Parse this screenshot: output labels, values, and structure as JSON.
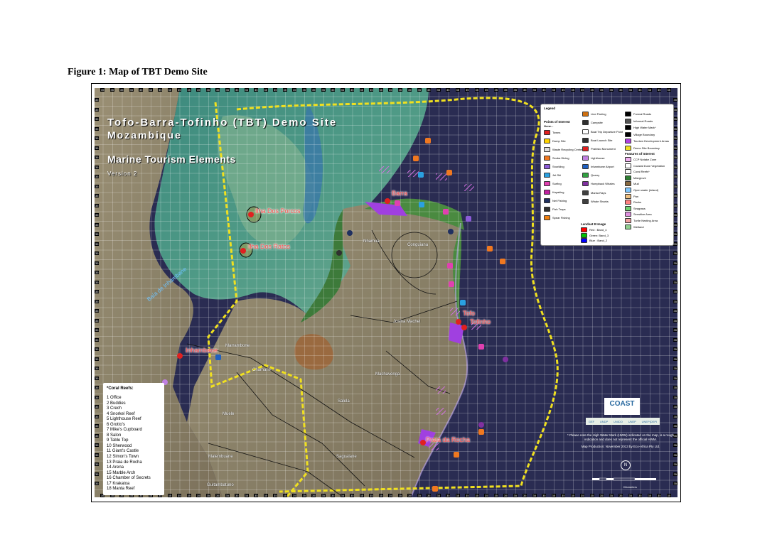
{
  "caption": "Figure 1: Map of TBT Demo Site",
  "map": {
    "title_line1": "Tofo-Barra-Tofinho (TBT) Demo Site",
    "title_line2": "Mozambique",
    "subtitle": "Marine Tourism Elements",
    "version": "Version 2",
    "places": {
      "ilha_porcos": "Ilha Dos Porcos",
      "ilha_ratos": "Ilha Dos Ratos",
      "inhambane": "Inhambane",
      "barra": "Barra",
      "tofo": "Tofo",
      "tofinho": "Tofinho",
      "praia_rocha": "Praia da Rocha"
    },
    "districts": {
      "conguiana": "Conguiana",
      "josina_machel": "Josina Machel",
      "marrambone": "Marrambone",
      "chamane": "Chamane",
      "nhamua": "Nhamua",
      "muele": "Muele",
      "malembuane": "Malembuane",
      "guitambatuno": "Guitambatuno",
      "salela": "Salela",
      "sagualane": "Sagualane",
      "machavenga": "Machavenga"
    },
    "bay_label": "Baía de Inhambane",
    "grid_edge_label": "35"
  },
  "legend": {
    "title": "Legend",
    "poi_heading": "Points of Interest",
    "poi_sub": "Gene...",
    "items_col1": [
      {
        "label": "Towns",
        "color": "#e02020"
      },
      {
        "label": "Dump Site",
        "color": "#ffd400"
      },
      {
        "label": "Waste Recycling Centre",
        "color": "#dddddd"
      },
      {
        "label": "Scuba Diving",
        "color": "#f07820"
      },
      {
        "label": "Snorkling",
        "color": "#8c5cd8"
      },
      {
        "label": "Jet Ski",
        "color": "#2aa0e0"
      },
      {
        "label": "Surfing",
        "color": "#e040b0"
      },
      {
        "label": "Kayaking",
        "color": "#c020a0"
      },
      {
        "label": "Net Fishing",
        "color": "#203060"
      },
      {
        "label": "Fish Traps",
        "color": "#303030"
      },
      {
        "label": "Spear Fishing",
        "color": "#f08010"
      }
    ],
    "items_col2": [
      {
        "label": "Line Fishing",
        "color": "#d07010"
      },
      {
        "label": "Campsite",
        "color": "#303030"
      },
      {
        "label": "Boat Trip Departure Point",
        "color": "#ffffff"
      },
      {
        "label": "Boat Launch Site",
        "color": "#303030"
      },
      {
        "label": "Prahisto Monument",
        "color": "#e02020"
      },
      {
        "label": "Lighthouse",
        "color": "#c080e0"
      },
      {
        "label": "Inhambane Airport",
        "color": "#2060c0"
      },
      {
        "label": "Quarry",
        "color": "#30a040"
      },
      {
        "label": "Humpback Whales",
        "color": "#8030a0"
      },
      {
        "label": "Manta Rays",
        "color": "#404040"
      },
      {
        "label": "Whale Sharks",
        "color": "#404040"
      }
    ],
    "items_col3": [
      {
        "label": "Formal Roads",
        "color": "#000000"
      },
      {
        "label": "Informal Roads",
        "color": "#555555"
      },
      {
        "label": "High Water Mark*",
        "color": "#000000"
      },
      {
        "label": "Village Boundary",
        "color": "#000000"
      },
      {
        "label": "Tourism Development Areas",
        "color": "#b040e0"
      },
      {
        "label": "Demo Site Boundary",
        "color": "#f0e020"
      }
    ],
    "foi_heading": "Features of Interest",
    "foi_items": [
      {
        "label": "CCP Notake Zone",
        "color": "#f0b0f0"
      },
      {
        "label": "Coastal Dune Vegetation",
        "color": "#ffffff"
      },
      {
        "label": "Coral Reefs*",
        "color": "#ffffff"
      },
      {
        "label": "Mangrove",
        "color": "#2e7d32"
      },
      {
        "label": "Mud",
        "color": "#8a6a40"
      },
      {
        "label": "Open water (inland)",
        "color": "#80c8ff"
      },
      {
        "label": "Pan",
        "color": "#f0c080"
      },
      {
        "label": "Rocks",
        "color": "#ff8080"
      },
      {
        "label": "Seagrass",
        "color": "#70d070"
      },
      {
        "label": "Sensitive Area",
        "color": "#e090e0"
      },
      {
        "label": "Turtle Nesting Area",
        "color": "#f0a0a0"
      },
      {
        "label": "Wetland",
        "color": "#90d090"
      }
    ],
    "landsat_heading": "Landsat 8 Image",
    "landsat_items": [
      {
        "label": "Red : Band_4",
        "color": "#ff0000"
      },
      {
        "label": "Green: Band_3",
        "color": "#00c000"
      },
      {
        "label": "Blue : Band_2",
        "color": "#0000ff"
      }
    ]
  },
  "reefs": {
    "title": "*Coral Reefs:",
    "items": [
      "1 Office",
      "2 Buddies",
      "3 Crech",
      "4 Snorkel Reef",
      "5 Lighthouse Reef",
      "6 Grotto's",
      "7 Mike's Cupboard",
      "8 Salon",
      "9 Table Top",
      "10 Sherwood",
      "11 Giant's Castle",
      "12 Simon's Town",
      "13 Praia de Rocha",
      "14 Arena",
      "15 Marble Arch",
      "16 Chamber of Secrets",
      "17 Krakatoa",
      "18 Manta Reef"
    ]
  },
  "logo": {
    "name": "COAST",
    "partners": [
      "GEF",
      "UNDP",
      "UNIDO",
      "UNEP",
      "UNEP|DEPI"
    ]
  },
  "notes": {
    "hwm": "* Please note the High Water Mark (HWM) indicated on the map, is a rough indication and does not represent the official HWM.",
    "production": "Map Production: November 2013 by Eco-Africa Pty Ltd."
  },
  "scale": {
    "label": "Kilometers",
    "north": "N"
  }
}
